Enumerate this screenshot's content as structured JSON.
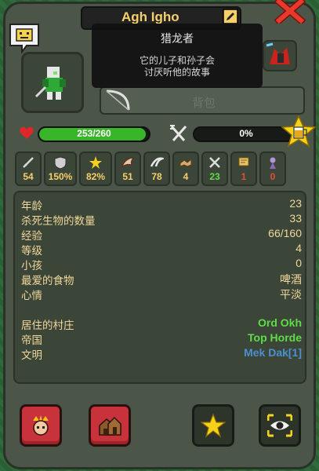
{
  "header": {
    "creature_name": "Agh Igho"
  },
  "tooltip": {
    "title": "猎龙者",
    "description": "它的儿子和孙子会\n讨厌听他的故事"
  },
  "inventory": {
    "backpack_label": "背包"
  },
  "vitals": {
    "hp_text": "253/260",
    "hp_fraction": 0.973,
    "hunger_text": "0%",
    "hunger_fraction": 0.0
  },
  "stats": [
    {
      "icon": "sword-icon",
      "value": "54",
      "color": "#f6d06b"
    },
    {
      "icon": "shield-icon",
      "value": "150%",
      "color": "#f6d06b"
    },
    {
      "icon": "crit-star-icon",
      "value": "82%",
      "color": "#f6d06b"
    },
    {
      "icon": "wing-speed-icon",
      "value": "51",
      "color": "#f6d06b"
    },
    {
      "icon": "attack-speed-icon",
      "value": "78",
      "color": "#f6d06b"
    },
    {
      "icon": "diplomacy-icon",
      "value": "4",
      "color": "#f6d06b"
    },
    {
      "icon": "warfare-icon",
      "value": "23",
      "color": "#5fdc4a"
    },
    {
      "icon": "stewardship-icon",
      "value": "1",
      "color": "#e84a3a"
    },
    {
      "icon": "intelligence-icon",
      "value": "0",
      "color": "#e84a3a"
    }
  ],
  "info": [
    {
      "label": "年龄",
      "value": "23",
      "value_color": "#f0d89a"
    },
    {
      "label": "杀死生物的数量",
      "value": "33",
      "value_color": "#f0d89a"
    },
    {
      "label": "经验",
      "value": "66/160",
      "value_color": "#f0d89a"
    },
    {
      "label": "等级",
      "value": "4",
      "value_color": "#f0d89a"
    },
    {
      "label": "小孩",
      "value": "0",
      "value_color": "#f0d89a"
    },
    {
      "label": "最爱的食物",
      "value": "啤酒",
      "value_color": "#f0d89a"
    },
    {
      "label": "心情",
      "value": "平淡",
      "value_color": "#f0d89a"
    },
    {
      "label": "居住的村庄",
      "value": "Ord Okh",
      "value_color": "#5fdc4a"
    },
    {
      "label": "帝国",
      "value": "Top Horde",
      "value_color": "#5fdc4a"
    },
    {
      "label": "文明",
      "value": "Mek Dak[1]",
      "value_color": "#4d8fd0"
    }
  ],
  "colors": {
    "panel": "#4c5648",
    "accent_gold": "#f6d06b",
    "hp_green": "#39b52a",
    "button_red": "#c8323a"
  }
}
